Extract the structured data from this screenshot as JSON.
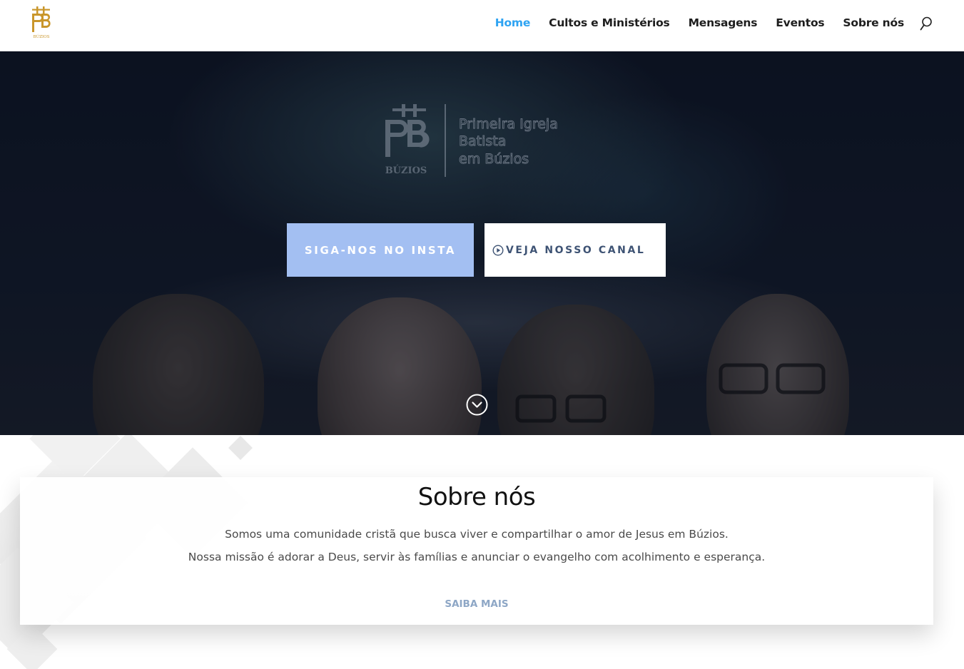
{
  "header": {
    "logo_label": "BÚZIOS",
    "nav": [
      {
        "label": "Home",
        "active": true
      },
      {
        "label": "Cultos e Ministérios",
        "active": false
      },
      {
        "label": "Mensagens",
        "active": false
      },
      {
        "label": "Eventos",
        "active": false
      },
      {
        "label": "Sobre nós",
        "active": false
      }
    ],
    "search_icon": "search-icon"
  },
  "hero": {
    "logo_text": [
      "Primeira Igreja",
      "Batista",
      "em Búzios"
    ],
    "logo_mark": "BÚZIOS",
    "buttons": {
      "insta_label": "SIGA-NOS NO INSTA",
      "canal_label": "VEJA NOSSO CANAL"
    },
    "scroll_icon": "chevron-down-circle-icon"
  },
  "about": {
    "title": "Sobre nós",
    "line1": "Somos uma comunidade cristã que busca viver e compartilhar o amor de Jesus em Búzios.",
    "line2": "Nossa missão é adorar a Deus, servir às famílias e anunciar o evangelho com acolhimento e esperança.",
    "link_label": "SAIBA MAIS"
  },
  "colors": {
    "accent_nav": "#2ea3f2",
    "insta_button": "#a3bff2",
    "canal_text": "#3e5374",
    "saiba_link": "#8ea7c6",
    "logo_gold": "#c9962b"
  }
}
